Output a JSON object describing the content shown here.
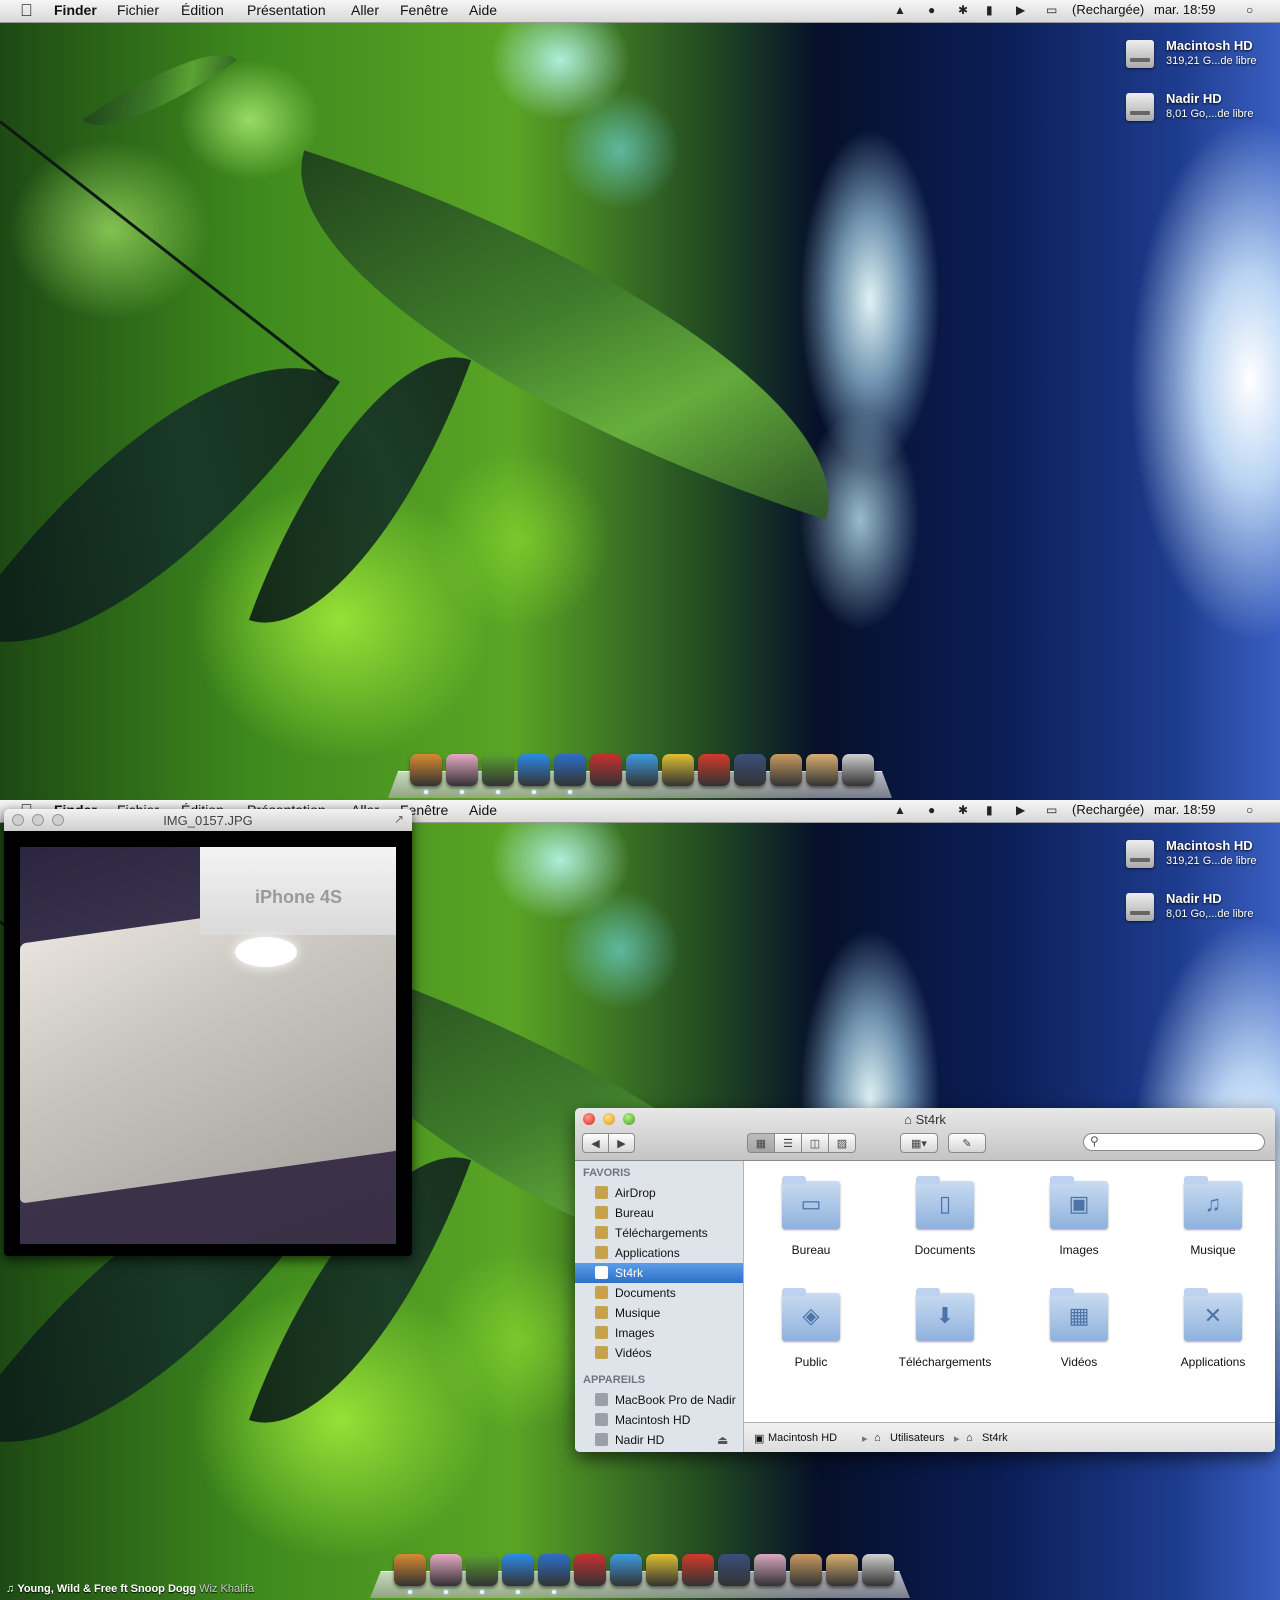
{
  "menubar": {
    "app": "Finder",
    "items": [
      "Fichier",
      "Édition",
      "Présentation",
      "Aller",
      "Fenêtre",
      "Aide"
    ],
    "battery": "(Rechargée)",
    "clock": "mar. 18:59",
    "icons": [
      "apple-icon",
      "cat-icon",
      "chat-icon",
      "bluetooth-icon",
      "signal-icon",
      "volume-icon",
      "battery-icon",
      "spotlight-icon"
    ]
  },
  "volumes": [
    {
      "name": "Macintosh HD",
      "free": "319,21 G...de libre"
    },
    {
      "name": "Nadir HD",
      "free": "8,01 Go,...de libre"
    }
  ],
  "image_window": {
    "title": "IMG_0157.JPG",
    "box_text": "iPhone 4S"
  },
  "finder": {
    "title": "St4rk",
    "sidebar": {
      "favorites_header": "FAVORIS",
      "favorites": [
        {
          "label": "AirDrop",
          "icon": "airdrop-icon"
        },
        {
          "label": "Bureau",
          "icon": "desktop-icon"
        },
        {
          "label": "Téléchargements",
          "icon": "downloads-icon"
        },
        {
          "label": "Applications",
          "icon": "applications-icon"
        },
        {
          "label": "St4rk",
          "icon": "home-icon",
          "selected": true
        },
        {
          "label": "Documents",
          "icon": "documents-icon"
        },
        {
          "label": "Musique",
          "icon": "music-icon"
        },
        {
          "label": "Images",
          "icon": "images-icon"
        },
        {
          "label": "Vidéos",
          "icon": "videos-icon"
        }
      ],
      "devices_header": "APPAREILS",
      "devices": [
        {
          "label": "MacBook Pro de Nadir",
          "icon": "laptop-icon"
        },
        {
          "label": "Macintosh HD",
          "icon": "disk-icon"
        },
        {
          "label": "Nadir HD",
          "icon": "disk-icon",
          "eject": true
        }
      ]
    },
    "folders": [
      {
        "label": "Bureau",
        "glyph": "▭"
      },
      {
        "label": "Documents",
        "glyph": "▯"
      },
      {
        "label": "Images",
        "glyph": "▣"
      },
      {
        "label": "Musique",
        "glyph": "♫"
      },
      {
        "label": "Public",
        "glyph": "◈"
      },
      {
        "label": "Téléchargements",
        "glyph": "⬇"
      },
      {
        "label": "Vidéos",
        "glyph": "▦"
      },
      {
        "label": "Applications",
        "glyph": "✕"
      }
    ],
    "path": [
      "Macintosh HD",
      "Utilisateurs",
      "St4rk"
    ]
  },
  "now_playing": {
    "title": "Young, Wild & Free ft Snoop Dogg",
    "artist": "Wiz Khalifa"
  },
  "dock": {
    "icon_names": [
      "finder-icon",
      "eye-icon",
      "adium-icon",
      "itunes-icon",
      "app-store-icon",
      "pokeball-icon",
      "twitter-icon",
      "notes-icon",
      "coda-icon",
      "aperture-icon",
      "photo-icon",
      "documents-stack-icon",
      "downloads-stack-icon",
      "trash-icon"
    ],
    "colors": [
      "#d88a2f",
      "#e8a9c4",
      "#5aa232",
      "#2c8ae8",
      "#2e6fc8",
      "#c83030",
      "#3e9be0",
      "#e0c030",
      "#d23a2a",
      "#3a4f7a",
      "#d9a8c2",
      "#c89a60",
      "#d8b070",
      "#d0d0d0"
    ]
  }
}
